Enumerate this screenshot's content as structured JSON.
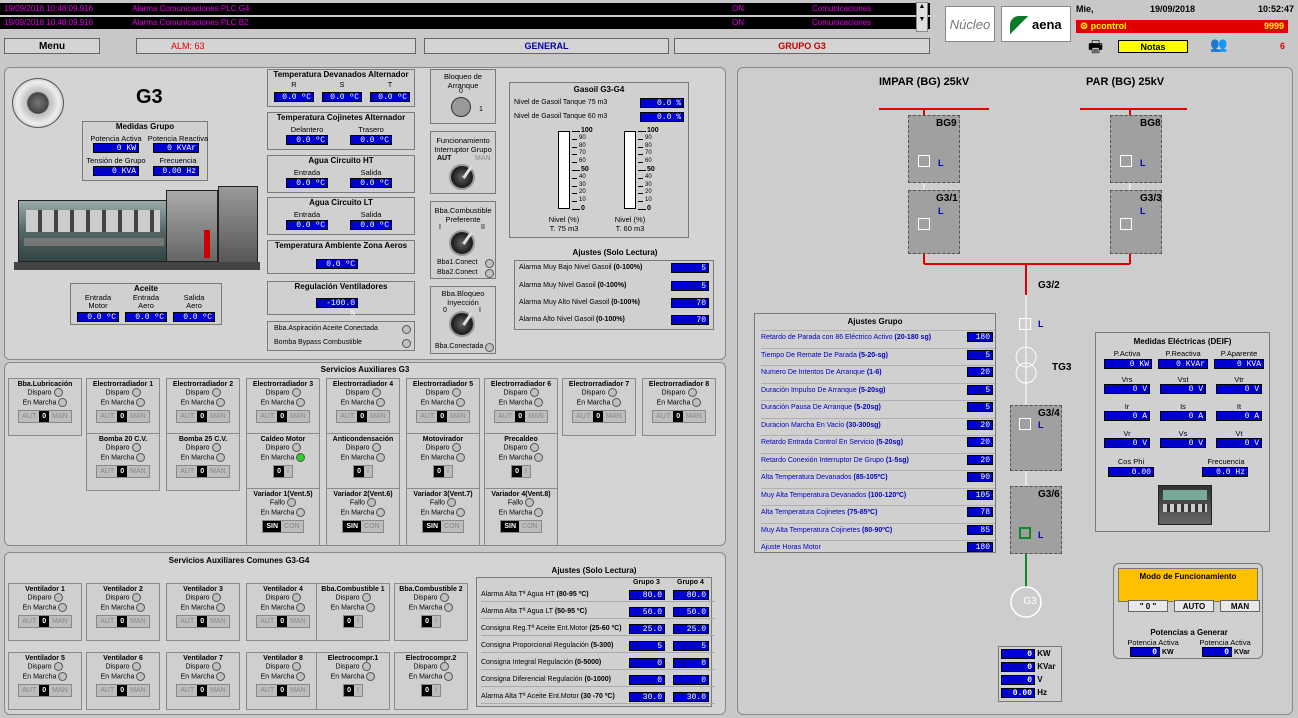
{
  "alarms": [
    {
      "ts": "19/09/2018 10:48:09.916",
      "text": "Alarma Comunicaciones PLC G4",
      "state": "ON",
      "cat": "Comunicaciones"
    },
    {
      "ts": "19/09/2018 10:48:09.916",
      "text": "Alarma Comunicaciones PLC B2",
      "state": "ON",
      "cat": "Comunicaciones"
    }
  ],
  "header": {
    "day": "Mie,",
    "date": "19/09/2018",
    "time": "10:52:47",
    "user": "pcontrol",
    "user_count": "9999",
    "notes": "Notas",
    "notes_count": "6",
    "nucleo": "Núcleo",
    "aena": "aena"
  },
  "nav": {
    "menu": "Menu",
    "alm_label": "ALM:",
    "alm_value": "63",
    "general": "GENERAL",
    "grupo": "GRUPO G3"
  },
  "g3": {
    "title": "G3",
    "estop_text": "EMERGENCY STOP",
    "medidas": {
      "title": "Medidas Grupo",
      "pa": "Potencia Activa",
      "pr": "Potencia Reactiva",
      "pa_v": "0",
      "pa_u": "KW",
      "pr_v": "0",
      "pr_u": "KVAr",
      "tg": "Tensión de Grupo",
      "fr": "Frecuencia",
      "tg_v": "0",
      "tg_u": "KVA",
      "fr_v": "0.00",
      "fr_u": "Hz"
    },
    "aceite": {
      "title": "Aceite",
      "c1": "Entrada",
      "c1b": "Motor",
      "c2": "Entrada",
      "c2b": "Aero",
      "c3": "Salida",
      "c3b": "Aero",
      "v1": "0.0 ºC",
      "v2": "0.0 ºC",
      "v3": "0.0 ºC"
    },
    "tdev": {
      "title": "Temperatura Devanados Alternador",
      "r": "R",
      "s": "S",
      "t": "T",
      "vr": "0.0 ºC",
      "vs": "0.0 ºC",
      "vt": "0.0 ºC"
    },
    "tcoj": {
      "title": "Temperatura Cojinetes Alternador",
      "a": "Delantero",
      "b": "Trasero",
      "va": "0.0 ºC",
      "vb": "0.0 ºC"
    },
    "aht": {
      "title": "Agua Circuito HT",
      "a": "Entrada",
      "b": "Salida",
      "va": "0.0 ºC",
      "vb": "0.0 ºC"
    },
    "alt": {
      "title": "Agua Circuito LT",
      "a": "Entrada",
      "b": "Salida",
      "va": "0.0 ºC",
      "vb": "0.0 ºC"
    },
    "tamb": {
      "title": "Temperatura Ambiente Zona Aeros",
      "v": "0.0 ºC"
    },
    "reg": {
      "title": "Regulación Ventiladores",
      "v": "-100.0 %"
    },
    "bba1": "Bba.Aspiración Aceite Conectada",
    "bba2": "Bomba Bypass Combustible",
    "bloqueo": {
      "t1": "Bloqueo de",
      "t2": "Arranque",
      "o": "0",
      "i": "1"
    },
    "func": {
      "t1": "Funcionamiento",
      "t2": "Interruptor Grupo",
      "aut": "AUT",
      "man": "MAN"
    },
    "comb": {
      "t1": "Bba.Combustible",
      "t2": "Preferente",
      "i": "I",
      "ii": "II",
      "c1": "Bba1.Conect",
      "c2": "Bba2.Conect"
    },
    "iny": {
      "t1": "Bba.Bloqueo",
      "t2": "Inyección",
      "o": "0",
      "i": "I",
      "c": "Bba.Conectada"
    }
  },
  "gasoil": {
    "title": "Gasoil G3-G4",
    "n75": "Nivel de Gasoil Tanque 75 m3",
    "n60": "Nivel de Gasoil Tanque 60 m3",
    "v75": "0.0 %",
    "v60": "0.0 %",
    "ticks": [
      "100",
      "90",
      "80",
      "70",
      "60",
      "50",
      "40",
      "30",
      "20",
      "10",
      "0"
    ],
    "level_75": 0,
    "level_60": 0,
    "cap1": "Nivel (%)",
    "cap1b": "T. 75 m3",
    "cap2": "Nivel (%)",
    "cap2b": "T. 60 m3",
    "aj_title": "Ajustes (Solo Lectura)",
    "aj": [
      {
        "l": "Alarma Muy Bajo Nivel Gasoil",
        "r": "(0-100%)",
        "v": "5"
      },
      {
        "l": "Alarma Muy Nivel Gasoil",
        "r": "(0-100%)",
        "v": "5"
      },
      {
        "l": "Alarma Muy Alto Nivel Gasoil",
        "r": "(0-100%)",
        "v": "70"
      },
      {
        "l": "Alarma Alto Nivel Gasoil",
        "r": "(0-100%)",
        "v": "70"
      }
    ]
  },
  "serv": {
    "title": "Servicios Auxiliares G3",
    "disparo": "Disparo",
    "marcha": "En Marcha",
    "fallo": "Fallo",
    "aut": "AUT",
    "zero": "0",
    "man": "MAN",
    "i": "I",
    "sin": "SIN",
    "con": "CON",
    "row1": [
      "Bba.Lubricación",
      "Electrorradiador 1",
      "Electrorradiador 2",
      "Electrorradiador 3",
      "Electrorradiador 4",
      "Electrorradiador 5",
      "Electrorradiador 6",
      "Electrorradiador 7",
      "Electrorradiador 8"
    ],
    "row2": [
      "Bomba 20 C.V.",
      "Bomba 25 C.V.",
      "Caldeo Motor",
      "Anticondensación",
      "Motovirador",
      "Precaldeo"
    ],
    "row3": [
      "Variador 1(Vent.5)",
      "Variador 2(Vent.6)",
      "Variador 3(Vent.7)",
      "Variador 4(Vent.8)"
    ]
  },
  "comun": {
    "title": "Servicios Auxiliares Comunes G3-G4",
    "row1": [
      "Ventilador 1",
      "Ventilador 2",
      "Ventilador 3",
      "Ventilador 4",
      "Bba.Combustible 1",
      "Bba.Combustible 2"
    ],
    "row2": [
      "Ventilador 5",
      "Ventilador 6",
      "Ventilador 7",
      "Ventilador 8",
      "Electrocompr.1",
      "Electrocompr.2"
    ],
    "aj_title": "Ajustes (Solo Lectura)",
    "g3": "Grupo 3",
    "g4": "Grupo 4",
    "aj": [
      {
        "l": "Alarma Alta Tª Agua HT",
        "r": "(80-95 ºC)",
        "a": "80.0",
        "b": "80.0"
      },
      {
        "l": "Alarma Alta Tª Agua LT",
        "r": "(50-95 ºC)",
        "a": "50.0",
        "b": "50.0"
      },
      {
        "l": "Consigna Reg.Tª Aceite Ent.Motor",
        "r": "(25-60 ºC)",
        "a": "25.0",
        "b": "25.0"
      },
      {
        "l": "Consigna Proporcional Regulación",
        "r": "(5-300)",
        "a": "5",
        "b": "5"
      },
      {
        "l": "Consigna Integral Regulación",
        "r": "(0-5000)",
        "a": "0",
        "b": "0"
      },
      {
        "l": "Consigna Diferencial Regulación",
        "r": "(0-1000)",
        "a": "0",
        "b": "0"
      },
      {
        "l": "Alarma Alta Tª Aceite Ent.Motor",
        "r": "(30 -70 ºC)",
        "a": "30.0",
        "b": "30.0"
      }
    ]
  },
  "ajg": {
    "title": "Ajustes Grupo",
    "rows": [
      {
        "l": "Retardo de Parada con 86 Eléctrico Activo",
        "r": "(20-180 sg)",
        "v": "180"
      },
      {
        "l": "Tiempo De Remate De Parada",
        "r": "(5-20-sg)",
        "v": "5"
      },
      {
        "l": "Numero De Intentos De Arranque",
        "r": "(1-6)",
        "v": "20"
      },
      {
        "l": "Duración Impulso De Arranque",
        "r": "(5-20sg)",
        "v": "5"
      },
      {
        "l": "Duración Pausa De Arranque",
        "r": "(5-20sg)",
        "v": "5"
      },
      {
        "l": "Duracion Marcha En Vacío",
        "r": "(30-300sg)",
        "v": "20"
      },
      {
        "l": "Retardo Entrada Control En Servicio",
        "r": "(5-20sg)",
        "v": "20"
      },
      {
        "l": "Retardo Conexión Interruptor De Grupo",
        "r": "(1-5sg)",
        "v": "20"
      },
      {
        "l": "Alta Temperatura Devanados",
        "r": "(85-105ºC)",
        "v": "90"
      },
      {
        "l": "Muy Alta Temperatura Devanados",
        "r": "(100-120ºC)",
        "v": "105"
      },
      {
        "l": "Alta Temperatura Cojinetes",
        "r": "(75-85ºC)",
        "v": "78"
      },
      {
        "l": "Muy Alta Temperatura Cojinetes",
        "r": "(80-90ºC)",
        "v": "85"
      },
      {
        "l": "Ajuste Horas Motor",
        "r": "",
        "v": "180"
      }
    ]
  },
  "single": {
    "impar": "IMPAR (BG) 25kV",
    "par": "PAR (BG) 25kV",
    "bg9": "BG9",
    "bg8": "BG8",
    "g31": "G3/1",
    "g33": "G3/3",
    "g32": "G3/2",
    "tg3": "TG3",
    "g34": "G3/4",
    "g36": "G3/6",
    "gen": "G3",
    "L": "L"
  },
  "deif": {
    "title": "Medidas Eléctricas (DEIF)",
    "pa": "P.Activa",
    "pr": "P.Reactiva",
    "pap": "P.Aparente",
    "pa_v": "0",
    "pa_u": "KW",
    "pr_v": "0",
    "pr_u": "KVAr",
    "pap_v": "0",
    "pap_u": "KVA",
    "vrs": "Vrs",
    "vst": "Vst",
    "vtr": "Vtr",
    "ir": "Ir",
    "is": "Is",
    "it": "It",
    "vr": "Vr",
    "vs": "Vs",
    "vt": "Vt",
    "zero": "0",
    "V": "V",
    "A": "A",
    "cos": "Cos Phi",
    "freq": "Frecuencia",
    "cos_v": "0.00",
    "freq_v": "0.0",
    "hz": "Hz"
  },
  "modo": {
    "title": "Modo de Funcionamiento",
    "b1": "\" 0 \"",
    "b2": "AUTO",
    "b3": "MAN",
    "pot": "Potencias a Generar",
    "pa": "Potencia Activa",
    "pa2": "Potencia Activa",
    "v1": "0",
    "u1": "KW",
    "v2": "0",
    "u2": "KVar"
  },
  "meter": {
    "kw": "0",
    "kw_u": "KW",
    "kvar": "0",
    "kvar_u": "KVar",
    "v": "0",
    "v_u": "V",
    "hz": "0.00",
    "hz_u": "Hz"
  }
}
